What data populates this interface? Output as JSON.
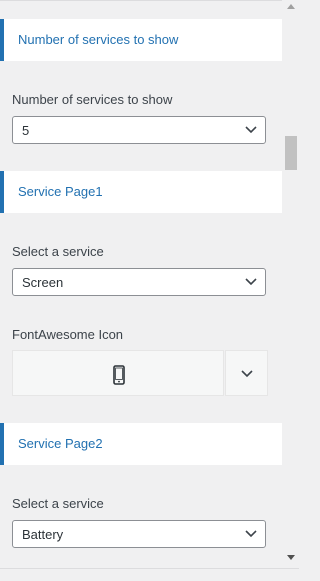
{
  "sections": [
    {
      "header": "Number of services to show",
      "field_label": "Number of services to show",
      "select_value": "5"
    },
    {
      "header": "Service Page1",
      "field_label": "Select a service",
      "select_value": "Screen",
      "icon_label": "FontAwesome Icon",
      "icon_name": "mobile-phone-icon"
    },
    {
      "header": "Service Page2",
      "field_label": "Select a service",
      "select_value": "Battery"
    }
  ],
  "colors": {
    "accent": "#2271b1",
    "background": "#f0f0f1",
    "text": "#3c434a"
  }
}
